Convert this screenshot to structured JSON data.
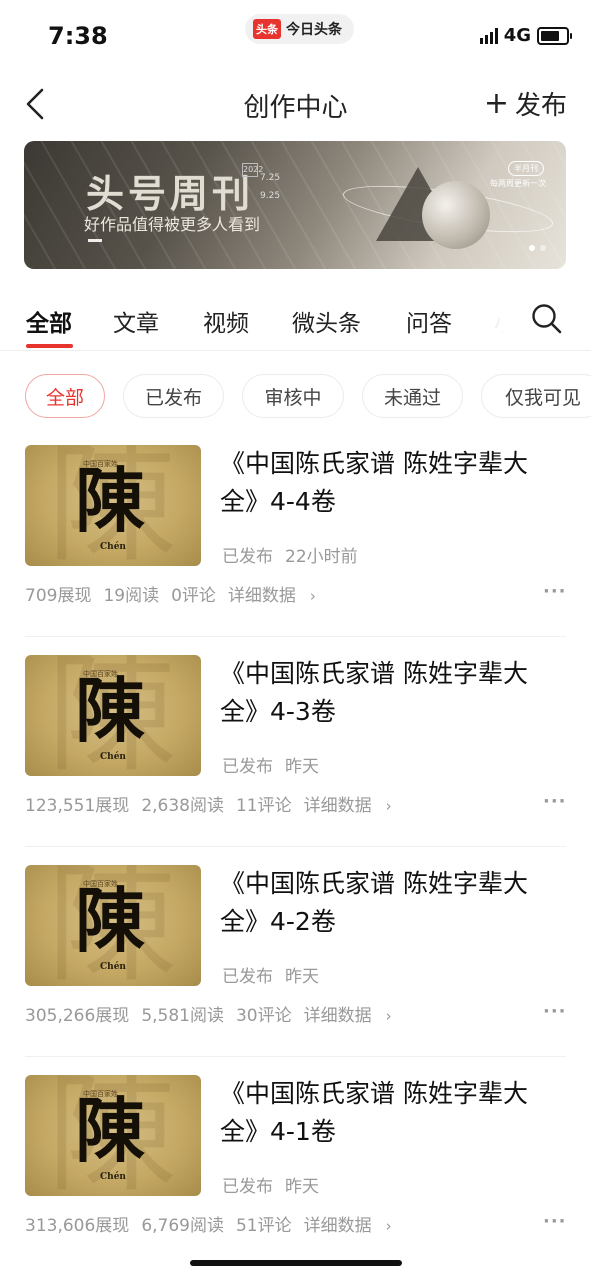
{
  "status_bar": {
    "time": "7:38",
    "app_badge": "头条",
    "app_name": "今日头条",
    "network": "4G"
  },
  "nav": {
    "back_icon": "chevron-left-icon",
    "title": "创作中心",
    "publish_label": "发布"
  },
  "banner": {
    "title": "头号周刊",
    "year": "2022",
    "date_start": "7.25",
    "date_end": "9.25",
    "subtitle": "好作品值得被更多人看到",
    "tag": "半月刊",
    "tag_sub": "每两周更新一次",
    "page_count": 2,
    "active_page": 1
  },
  "tabs": [
    {
      "label": "全部",
      "active": true
    },
    {
      "label": "文章",
      "active": false
    },
    {
      "label": "视频",
      "active": false
    },
    {
      "label": "微头条",
      "active": false
    },
    {
      "label": "问答",
      "active": false
    },
    {
      "label": "小",
      "active": false
    }
  ],
  "filters": [
    {
      "label": "全部",
      "active": true
    },
    {
      "label": "已发布",
      "active": false
    },
    {
      "label": "审核中",
      "active": false
    },
    {
      "label": "未通过",
      "active": false
    },
    {
      "label": "仅我可见",
      "active": false
    }
  ],
  "thumbnail": {
    "character": "陳",
    "pinyin": "Chén",
    "caption": "中国百家姓"
  },
  "items": [
    {
      "title": "《中国陈氏家谱 陈姓字辈大全》4-4卷",
      "status": "已发布",
      "time": "22小时前",
      "impressions": "709展现",
      "reads": "19阅读",
      "comments": "0评论",
      "detail_label": "详细数据"
    },
    {
      "title": "《中国陈氏家谱 陈姓字辈大全》4-3卷",
      "status": "已发布",
      "time": "昨天",
      "impressions": "123,551展现",
      "reads": "2,638阅读",
      "comments": "11评论",
      "detail_label": "详细数据"
    },
    {
      "title": "《中国陈氏家谱 陈姓字辈大全》4-2卷",
      "status": "已发布",
      "time": "昨天",
      "impressions": "305,266展现",
      "reads": "5,581阅读",
      "comments": "30评论",
      "detail_label": "详细数据"
    },
    {
      "title": "《中国陈氏家谱 陈姓字辈大全》4-1卷",
      "status": "已发布",
      "time": "昨天",
      "impressions": "313,606展现",
      "reads": "6,769阅读",
      "comments": "51评论",
      "detail_label": "详细数据"
    }
  ],
  "colors": {
    "accent": "#e8342f",
    "muted_text": "#999999",
    "thumbnail_gold": "#c4a864"
  }
}
